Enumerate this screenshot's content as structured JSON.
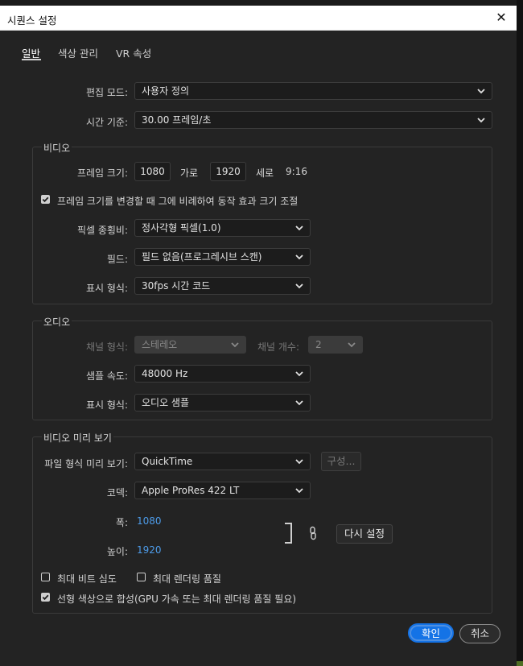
{
  "dialog": {
    "title": "시퀀스 설정",
    "close_label": "✕"
  },
  "tabs": [
    {
      "label": "일반",
      "active": true
    },
    {
      "label": "색상 관리",
      "active": false
    },
    {
      "label": "VR 속성",
      "active": false
    }
  ],
  "general": {
    "edit_mode_label": "편집 모드:",
    "edit_mode_value": "사용자 정의",
    "timebase_label": "시간 기준:",
    "timebase_value": "30.00  프레임/초"
  },
  "video": {
    "title": "비디오",
    "frame_size_label": "프레임 크기:",
    "frame_width": "1080",
    "horizontal_label": "가로",
    "frame_height": "1920",
    "vertical_label": "세로",
    "aspect": "9:16",
    "scale_checkbox_label": "프레임 크기를 변경할 때 그에 비례하여 동작 효과 크기 조절",
    "scale_checked": true,
    "pixel_aspect_label": "픽셀 종횡비:",
    "pixel_aspect_value": "정사각형 픽셀(1.0)",
    "fields_label": "필드:",
    "fields_value": "필드 없음(프로그레시브 스캔)",
    "display_format_label": "표시 형식:",
    "display_format_value": "30fps 시간 코드"
  },
  "audio": {
    "title": "오디오",
    "channel_format_label": "채널 형식:",
    "channel_format_value": "스테레오",
    "channel_count_label": "채널 개수:",
    "channel_count_value": "2",
    "sample_rate_label": "샘플 속도:",
    "sample_rate_value": "48000 Hz",
    "display_format_label": "표시 형식:",
    "display_format_value": "오디오 샘플"
  },
  "preview": {
    "title": "비디오 미리 보기",
    "file_format_label": "파일 형식 미리 보기:",
    "file_format_value": "QuickTime",
    "configure_label": "구성...",
    "codec_label": "코덱:",
    "codec_value": "Apple ProRes 422 LT",
    "width_label": "폭:",
    "width_value": "1080",
    "height_label": "높이:",
    "height_value": "1920",
    "reset_label": "다시 설정",
    "max_bit_depth_label": "최대 비트 심도",
    "max_bit_depth_checked": false,
    "max_render_quality_label": "최대 렌더링 품질",
    "max_render_quality_checked": false,
    "linear_color_label": "선형 색상으로 합성(GPU 가속 또는 최대 렌더링 품질 필요)",
    "linear_color_checked": true
  },
  "buttons": {
    "ok_label": "확인",
    "cancel_label": "취소"
  },
  "colors": {
    "accent": "#1473e6",
    "link_value": "#4d9be8",
    "background": "#232323"
  },
  "icons": {
    "dropdown": "chevron-down-icon",
    "link": "chain-link-icon",
    "close": "close-icon",
    "checkbox": "checkmark-icon"
  }
}
